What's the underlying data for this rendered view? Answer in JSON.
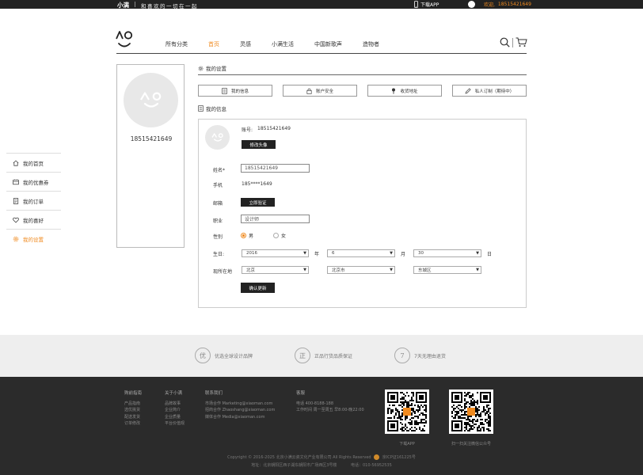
{
  "topbar": {
    "brand": "小满",
    "slogan": "和喜欢的一切在一起",
    "download_app": "下载APP",
    "welcome": "欢迎,",
    "phone": "18515421649"
  },
  "nav": {
    "items": [
      "所有分类",
      "首页",
      "灵感",
      "小满生活",
      "中国新歌声",
      "造物者"
    ],
    "active_index": 1
  },
  "sidebar": {
    "username": "18515421649",
    "items": [
      {
        "label": "我的首页",
        "icon": "home-icon"
      },
      {
        "label": "我的优惠券",
        "icon": "coupon-icon"
      },
      {
        "label": "我的订单",
        "icon": "order-icon"
      },
      {
        "label": "我的喜好",
        "icon": "heart-icon"
      },
      {
        "label": "我的设置",
        "icon": "gear-icon"
      }
    ],
    "active_index": 4
  },
  "settings": {
    "title": "我的设置",
    "buttons": [
      {
        "label": "我的信息",
        "icon": "document-icon"
      },
      {
        "label": "账户安全",
        "icon": "lock-icon"
      },
      {
        "label": "收货地址",
        "icon": "location-pin-icon"
      },
      {
        "label": "私人订制（期待中）",
        "icon": "pencil-icon"
      }
    ]
  },
  "info": {
    "title": "我的信息",
    "account_label": "账号:",
    "account_value": "18515421649",
    "change_avatar": "修改头像",
    "name_label": "姓名*",
    "name_value": "18515421649",
    "phone_label": "手机",
    "phone_value": "185****1649",
    "email_label": "邮箱",
    "verify_button": "立即验证",
    "job_label": "职业",
    "job_value": "设计师",
    "gender_label": "性别",
    "gender_male": "男",
    "gender_female": "女",
    "gender_selected": "男",
    "birthday_label": "生日:",
    "year_value": "2016",
    "year_unit": "年",
    "month_value": "6",
    "month_unit": "月",
    "day_value": "30",
    "day_unit": "日",
    "location_label": "现所在地",
    "province": "北京",
    "city": "北京市",
    "district": "东城区",
    "confirm_button": "确认更新"
  },
  "promo": [
    {
      "badge": "优",
      "text": "优选全球设计品牌"
    },
    {
      "badge": "正",
      "text": "正品行货品质保证"
    },
    {
      "badge": "7",
      "text": "7天无理由退货"
    }
  ],
  "footer": {
    "columns": [
      {
        "title": "购前指南",
        "items": [
          "产品指南",
          "选优挑货",
          "配送发货",
          "订单修改"
        ]
      },
      {
        "title": "关于小满",
        "items": [
          "品牌故事",
          "企业简介",
          "企业质量",
          "平台价值观"
        ]
      },
      {
        "title": "联系我们",
        "items": [
          "市场合作 Marketing@xiaoman.com",
          "招商合作 Zhaoshang@xiaoman.com",
          "媒体合作 Media@xiaoman.com"
        ]
      },
      {
        "title": "客服",
        "items": [
          "电话 400-8188-188",
          "工作时间 周一至周五 早8:00-晚22:00"
        ]
      }
    ],
    "qr": [
      {
        "caption": "下载APP"
      },
      {
        "caption": "扫一扫关注微信公众号"
      }
    ],
    "copyright": "Copyright © 2016-2025 北京小满云瓷文化产业有限公司 All Rights Reserved",
    "icp": "京ICP证161225号",
    "address": "地址：北京朝阳区西子湖东朝阳市广场西区3号楼",
    "tel": "电话：010-56952535"
  },
  "colors": {
    "accent": "#f08a1f",
    "dark": "#222222",
    "footer_bg": "#2b2b2b"
  }
}
